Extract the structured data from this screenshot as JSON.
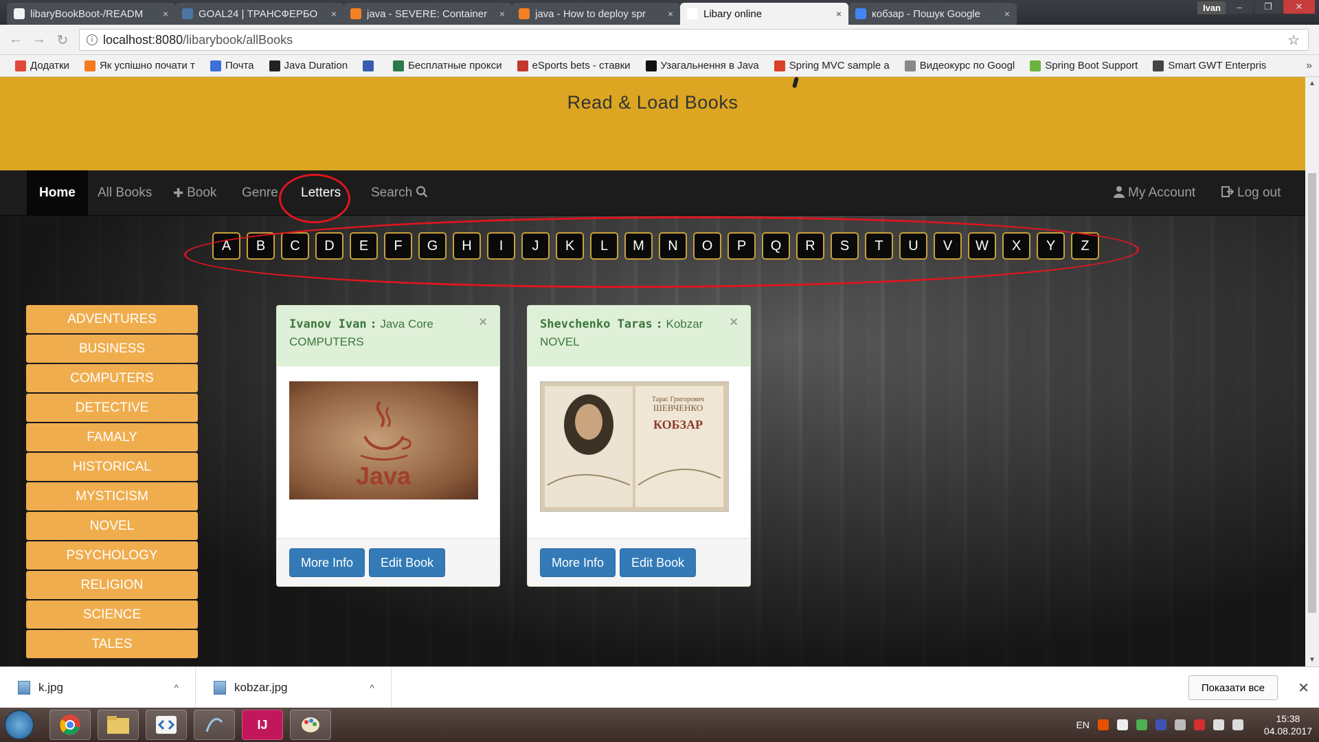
{
  "browser": {
    "tabs": [
      {
        "title": "libaryBookBoot-/READM",
        "icon_color": "#f2f2f2",
        "active": false
      },
      {
        "title": "GOAL24 | ТРАНСФЕРБО",
        "icon_color": "#4a76a8",
        "active": false
      },
      {
        "title": "java - SEVERE: Container",
        "icon_color": "#f48024",
        "active": false
      },
      {
        "title": "java - How to deploy spr",
        "icon_color": "#f48024",
        "active": false
      },
      {
        "title": "Libary online",
        "icon_color": "#ffffff",
        "active": true
      },
      {
        "title": "кобзар - Пошук Google",
        "icon_color": "#4285f4",
        "active": false
      }
    ],
    "tab_close": "×",
    "window_user": "Ivan",
    "window_controls": {
      "minimize": "–",
      "restore": "❐",
      "close": "✕"
    },
    "nav": {
      "back": "←",
      "forward": "→",
      "reload": "↻"
    },
    "address": {
      "host": "localhost:8080",
      "path": "/libarybook/allBooks"
    },
    "bookmark_star": "☆",
    "bookmarks": [
      {
        "label": "Додатки",
        "icon_color": "#e04a3a"
      },
      {
        "label": "Як успішно почати т",
        "icon_color": "#f47b20"
      },
      {
        "label": "Почта",
        "icon_color": "#3c6fd8"
      },
      {
        "label": "Java Duration",
        "icon_color": "#222222"
      },
      {
        "label": "",
        "icon_color": "#3b5bb0"
      },
      {
        "label": "Бесплатные прокси",
        "icon_color": "#2a7a4a"
      },
      {
        "label": "eSports bets - ставки",
        "icon_color": "#c0392b"
      },
      {
        "label": "Узагальнення в Java",
        "icon_color": "#111111"
      },
      {
        "label": "Spring MVC sample a",
        "icon_color": "#d9412b"
      },
      {
        "label": "Видеокурс по Googl",
        "icon_color": "#888888"
      },
      {
        "label": "Spring Boot Support",
        "icon_color": "#6db33f"
      },
      {
        "label": "Smart GWT Enterpris",
        "icon_color": "#444444"
      }
    ],
    "bookmarks_more": "»"
  },
  "site": {
    "slogan": "Read & Load Books",
    "nav": {
      "home": "Home",
      "all_books": "All Books",
      "add_book": "Book",
      "genre": "Genre",
      "letters": "Letters",
      "search": "Search",
      "my_account": "My Account",
      "log_out": "Log out"
    },
    "letters": [
      "A",
      "B",
      "C",
      "D",
      "E",
      "F",
      "G",
      "H",
      "I",
      "J",
      "K",
      "L",
      "M",
      "N",
      "O",
      "P",
      "Q",
      "R",
      "S",
      "T",
      "U",
      "V",
      "W",
      "X",
      "Y",
      "Z"
    ],
    "genres": [
      "ADVENTURES",
      "BUSINESS",
      "COMPUTERS",
      "DETECTIVE",
      "FAMALY",
      "HISTORICAL",
      "MYSTICISM",
      "NOVEL",
      "PSYCHOLOGY",
      "RELIGION",
      "SCIENCE",
      "TALES"
    ],
    "books": [
      {
        "author": "Ivanov Ivan",
        "title": "Java Core",
        "genre": "COMPUTERS",
        "cover_text": "Java",
        "more": "More Info",
        "edit": "Edit Book",
        "close": "×"
      },
      {
        "author": "Shevchenko Taras",
        "title": "Kobzar",
        "genre": "NOVEL",
        "cover_text": "КОБЗАР",
        "cover_author": "ШЕВЧЕНКО",
        "cover_author_first": "Тарас Григорович",
        "more": "More Info",
        "edit": "Edit Book",
        "close": "×"
      }
    ],
    "author_separator": ":",
    "annotation_color": "#e0151f"
  },
  "downloads": {
    "items": [
      {
        "name": "k.jpg"
      },
      {
        "name": "kobzar.jpg"
      }
    ],
    "caret": "^",
    "show_all": "Показати все",
    "close": "✕"
  },
  "taskbar": {
    "apps": [
      "chrome",
      "explorer",
      "code",
      "mysql",
      "IJ",
      "paint"
    ],
    "intellij_label": "IJ",
    "lang": "EN",
    "time": "15:38",
    "date": "04.08.2017"
  }
}
